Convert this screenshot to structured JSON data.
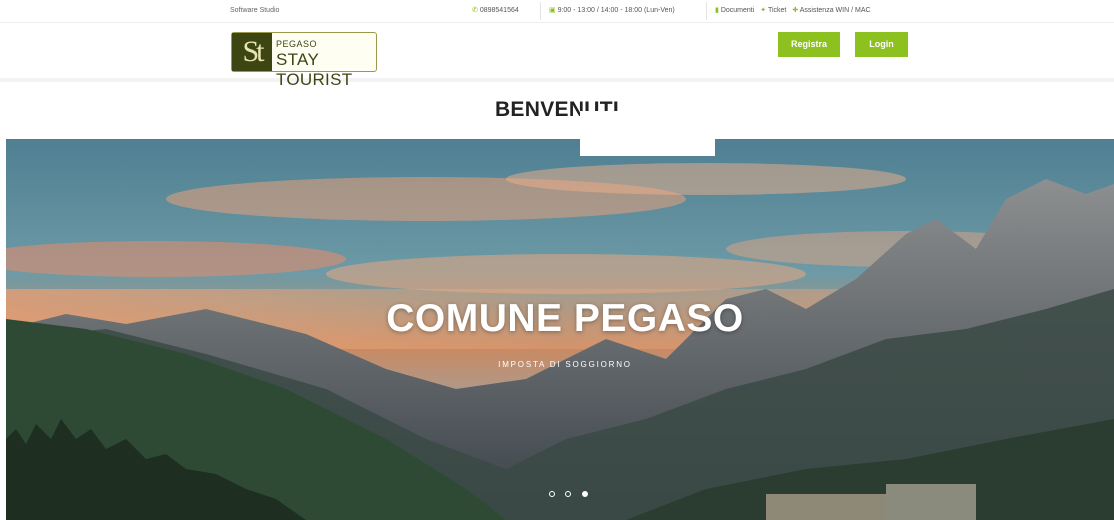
{
  "topbar": {
    "brand": "Software Studio",
    "phone": "0898541564",
    "hours": "9:00 - 13:00 / 14:00 - 18:00 (Lun-Ven)",
    "links": [
      {
        "label": "Documenti",
        "icon": "document-icon"
      },
      {
        "label": "Ticket",
        "icon": "ticket-icon"
      },
      {
        "label": "Assistenza WIN / MAC",
        "icon": "support-icon"
      }
    ]
  },
  "header": {
    "logo": {
      "mark": "St",
      "small": "PEGASO",
      "big": "STAY TOURIST"
    },
    "register_label": "Registra",
    "login_label": "Login"
  },
  "welcome": "BENVENUTI",
  "hero": {
    "title": "COMUNE PEGASO",
    "subtitle": "IMPOSTA DI SOGGIORNO",
    "slides": 3,
    "active_slide": 3
  },
  "colors": {
    "accent": "#8cc11f",
    "logo_dark": "#3d4612"
  }
}
